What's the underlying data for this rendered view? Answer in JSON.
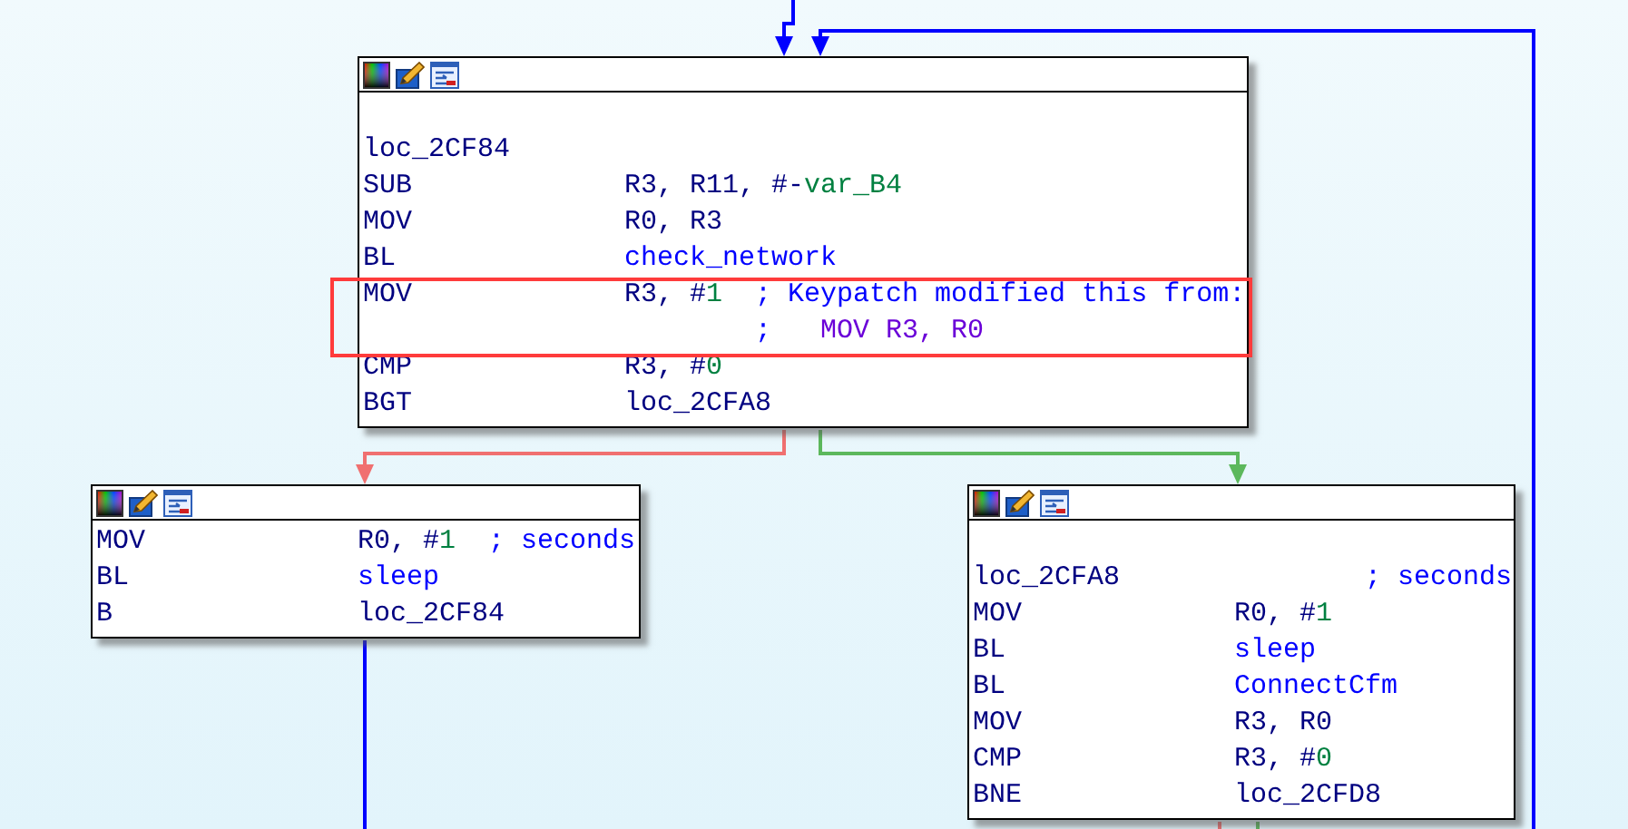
{
  "nodes": [
    {
      "lines": [
        {
          "kind": "blank",
          "highlighted": false
        },
        {
          "kind": "label",
          "label": "loc_2CF84",
          "highlighted": false
        },
        {
          "kind": "instr",
          "mnemonic": "SUB",
          "operand": [
            {
              "text": "R3, R11, #-",
              "kind": "reg"
            },
            {
              "text": "var_B4",
              "kind": "num"
            }
          ],
          "highlighted": false
        },
        {
          "kind": "instr",
          "mnemonic": "MOV",
          "operand": [
            {
              "text": "R0, R3",
              "kind": "reg"
            }
          ],
          "highlighted": false
        },
        {
          "kind": "instr",
          "mnemonic": "BL",
          "operand": [
            {
              "text": "check_network",
              "kind": "name"
            }
          ],
          "highlighted": false
        },
        {
          "kind": "instr",
          "mnemonic": "MOV",
          "operand": [
            {
              "text": "R3, #",
              "kind": "reg"
            },
            {
              "text": "1",
              "kind": "num"
            }
          ],
          "comment": [
            {
              "text": "; Keypatch modified this from:",
              "kind": "comment"
            }
          ],
          "highlighted": true
        },
        {
          "kind": "comment",
          "comment": [
            {
              "text": ";   ",
              "kind": "comment"
            },
            {
              "text": "MOV R3, R0",
              "kind": "code"
            }
          ],
          "highlighted": true
        },
        {
          "kind": "instr",
          "mnemonic": "CMP",
          "operand": [
            {
              "text": "R3, #",
              "kind": "reg"
            },
            {
              "text": "0",
              "kind": "num"
            }
          ],
          "highlighted": false
        },
        {
          "kind": "instr",
          "mnemonic": "BGT",
          "operand": [
            {
              "text": "loc_2CFA8",
              "kind": "reg"
            }
          ],
          "highlighted": false
        }
      ]
    },
    {
      "lines": [
        {
          "kind": "instr",
          "mnemonic": "MOV",
          "operand": [
            {
              "text": "R0, #",
              "kind": "reg"
            },
            {
              "text": "1",
              "kind": "num"
            }
          ],
          "comment": [
            {
              "text": "; seconds",
              "kind": "comment"
            }
          ],
          "highlighted": false
        },
        {
          "kind": "instr",
          "mnemonic": "BL",
          "operand": [
            {
              "text": "sleep",
              "kind": "name"
            }
          ],
          "highlighted": false
        },
        {
          "kind": "instr",
          "mnemonic": "B",
          "operand": [
            {
              "text": "loc_2CF84",
              "kind": "reg"
            }
          ],
          "highlighted": false
        }
      ]
    },
    {
      "lines": [
        {
          "kind": "blank",
          "highlighted": false
        },
        {
          "kind": "label",
          "label": "loc_2CFA8",
          "comment": [
            {
              "text": "; seconds",
              "kind": "comment"
            }
          ],
          "highlighted": false
        },
        {
          "kind": "instr",
          "mnemonic": "MOV",
          "operand": [
            {
              "text": "R0, #",
              "kind": "reg"
            },
            {
              "text": "1",
              "kind": "num"
            }
          ],
          "highlighted": false
        },
        {
          "kind": "instr",
          "mnemonic": "BL",
          "operand": [
            {
              "text": "sleep",
              "kind": "name"
            }
          ],
          "highlighted": false
        },
        {
          "kind": "instr",
          "mnemonic": "BL",
          "operand": [
            {
              "text": "ConnectCfm",
              "kind": "name"
            }
          ],
          "highlighted": false
        },
        {
          "kind": "instr",
          "mnemonic": "MOV",
          "operand": [
            {
              "text": "R3, R0",
              "kind": "reg"
            }
          ],
          "highlighted": false
        },
        {
          "kind": "instr",
          "mnemonic": "CMP",
          "operand": [
            {
              "text": "R3, #",
              "kind": "reg"
            },
            {
              "text": "0",
              "kind": "num"
            }
          ],
          "highlighted": false
        },
        {
          "kind": "instr",
          "mnemonic": "BNE",
          "operand": [
            {
              "text": "loc_2CFD8",
              "kind": "reg"
            }
          ],
          "highlighted": false
        }
      ]
    }
  ]
}
